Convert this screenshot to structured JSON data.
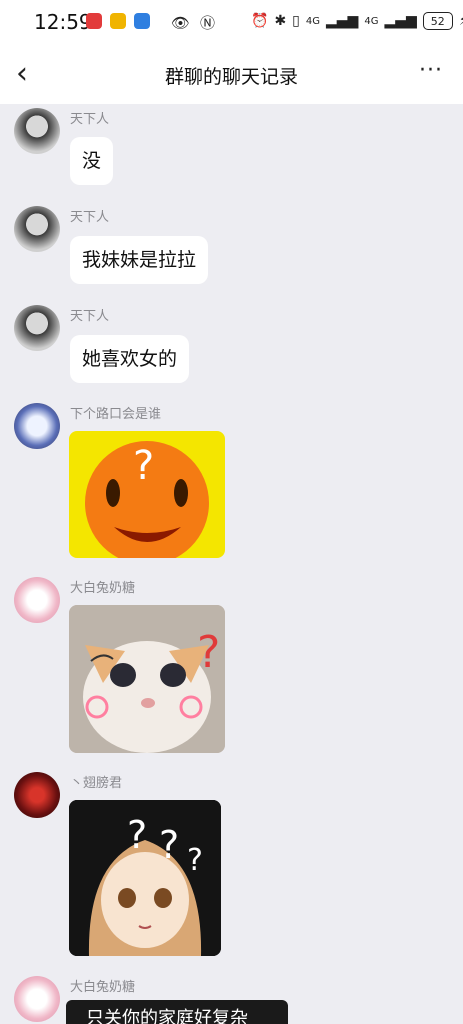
{
  "status": {
    "time": "12:59",
    "battery": "52",
    "signal1": "4G",
    "signal2": "4G"
  },
  "header": {
    "back_icon": "‹",
    "title": "群聊的聊天记录",
    "more_icon": "···"
  },
  "messages": [
    {
      "sender": "天下人",
      "text": "没"
    },
    {
      "sender": "天下人",
      "text": "我妹妹是拉拉"
    },
    {
      "sender": "天下人",
      "text": "她喜欢女的"
    },
    {
      "sender": "下个路口会是谁",
      "sticker": "orange-question-face"
    },
    {
      "sender": "大白兔奶糖",
      "sticker": "confused-kitten"
    },
    {
      "sender": "丶翅膀君",
      "sticker": "anime-girl-question-marks"
    },
    {
      "sender": "大白兔奶糖",
      "caption": "只关你的家庭好复杂"
    }
  ],
  "colors": {
    "bg": "#ededf2",
    "bubble": "#ffffff",
    "name": "#8a8a8f"
  }
}
